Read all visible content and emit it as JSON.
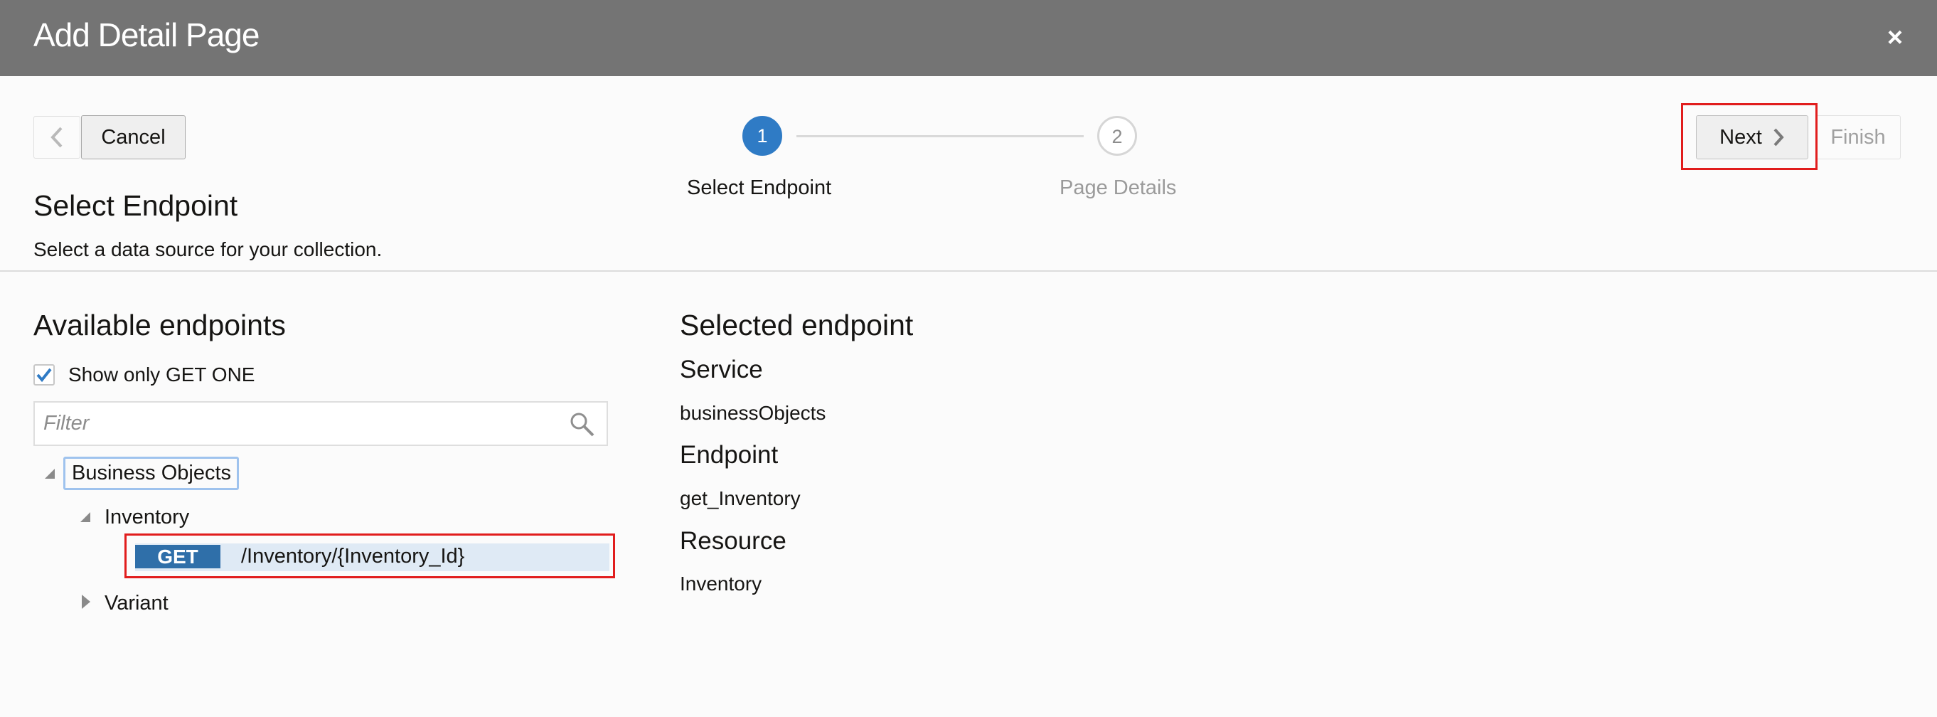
{
  "dialog": {
    "title": "Add Detail Page",
    "close_symbol": "×"
  },
  "toolbar": {
    "back_icon": "chevron-left-icon",
    "cancel_label": "Cancel",
    "next_label": "Next",
    "next_icon": "chevron-right-icon",
    "finish_label": "Finish"
  },
  "steps": [
    {
      "number": "1",
      "label": "Select Endpoint",
      "state": "active"
    },
    {
      "number": "2",
      "label": "Page Details",
      "state": "inactive"
    }
  ],
  "section": {
    "title": "Select Endpoint",
    "description": "Select a data source for your collection."
  },
  "available": {
    "heading": "Available endpoints",
    "checkbox_label": "Show only GET ONE",
    "checkbox_checked": true,
    "filter_placeholder": "Filter",
    "tree": {
      "root": "Business Objects",
      "children": [
        {
          "label": "Inventory",
          "expanded": true,
          "endpoints": [
            {
              "method": "GET",
              "path": "/Inventory/{Inventory_Id}"
            }
          ]
        },
        {
          "label": "Variant",
          "expanded": false
        }
      ]
    }
  },
  "selected": {
    "heading": "Selected endpoint",
    "service_label": "Service",
    "service_value": "businessObjects",
    "endpoint_label": "Endpoint",
    "endpoint_value": "get_Inventory",
    "resource_label": "Resource",
    "resource_value": "Inventory"
  },
  "colors": {
    "titlebar": "#747474",
    "accent": "#2f7bc5",
    "get_badge": "#2f6fa9",
    "selected_row": "#dfeaf5",
    "highlight_box": "#e11d1d"
  }
}
